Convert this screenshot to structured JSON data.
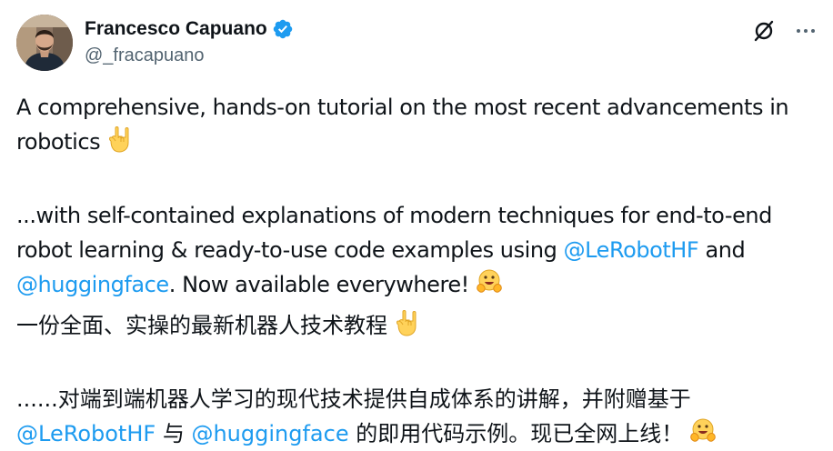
{
  "author": {
    "display_name": "Francesco Capuano",
    "handle": "@_fracapuano"
  },
  "tweet": {
    "p1_text": "A comprehensive, hands-on tutorial on the most recent advancements in robotics",
    "p2_text_a": "...with self-contained explanations of modern techniques for end-to-end robot learning & ready-to-use code examples using",
    "p2_mention_1": "@LeRobotHF",
    "p2_text_b": "and",
    "p2_mention_2": "@huggingface",
    "p2_text_c": ". Now available everywhere!",
    "p3_text": "一份全面、实操的最新机器人技术教程",
    "p4_text_a": "......对端到端机器人学习的现代技术提供自成体系的讲解，并附赠基于",
    "p4_mention_1": "@LeRobotHF",
    "p4_text_b": "与",
    "p4_mention_2": "@huggingface",
    "p4_text_c": "的即用代码示例。现已全网上线！"
  },
  "icons": {
    "verified": "verified-badge-icon",
    "grok": "grok-icon",
    "more": "more-icon",
    "rock_on": "sign-of-the-horns-emoji",
    "hug": "hugging-face-emoji"
  },
  "colors": {
    "text": "#0f1419",
    "secondary": "#536471",
    "link": "#1d9bf0",
    "verified": "#1d9bf0"
  }
}
